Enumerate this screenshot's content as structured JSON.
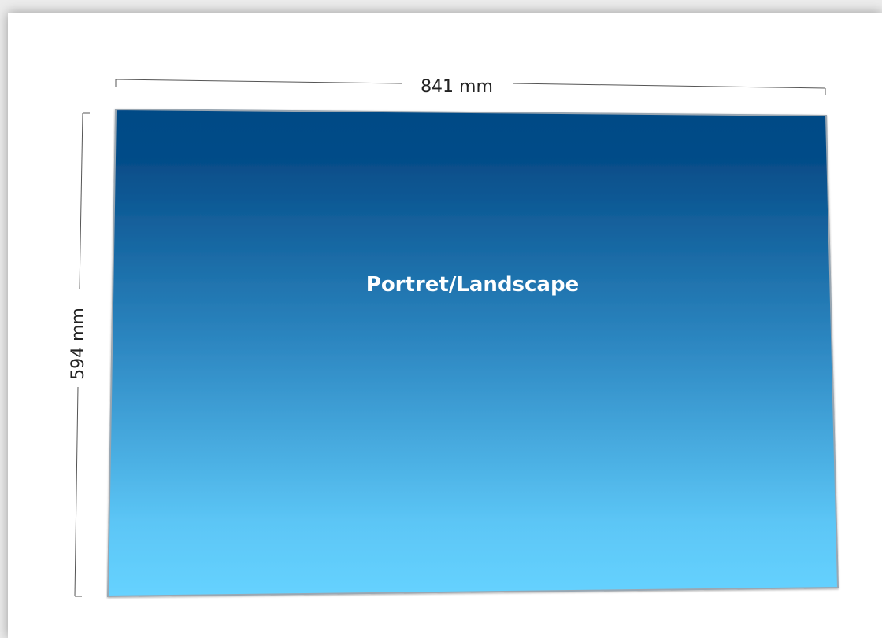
{
  "diagram": {
    "width_label": "841 mm",
    "height_label": "594 mm",
    "sheet_title": "Portret/Landscape"
  },
  "colors": {
    "sheet_top": "#034a86",
    "sheet_bottom": "#66d2ff",
    "dimension_line": "#555555",
    "background": "#ffffff"
  }
}
